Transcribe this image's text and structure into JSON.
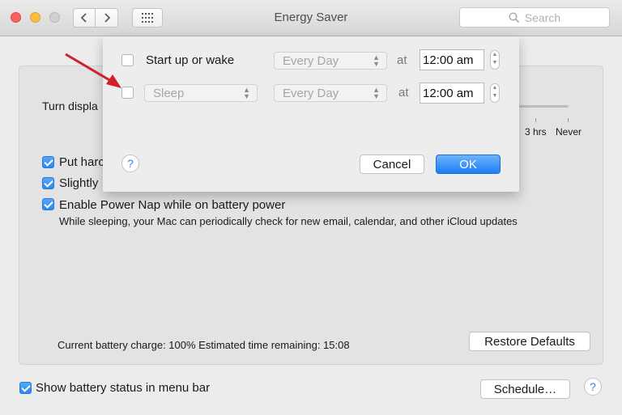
{
  "window": {
    "title": "Energy Saver",
    "search_placeholder": "Search"
  },
  "pane": {
    "turn_display_off_label": "Turn displa",
    "slider_tick_3hrs": "3 hrs",
    "slider_tick_never": "Never",
    "put_hard_disks_label": "Put harc",
    "slightly_dim_label": "Slightly",
    "power_nap_label": "Enable Power Nap while on battery power",
    "power_nap_desc": "While sleeping, your Mac can periodically check for new email, calendar, and other iCloud updates",
    "battery_status_text": "Current battery charge: 100%  Estimated time remaining: 15:08",
    "restore_defaults_label": "Restore Defaults"
  },
  "footer": {
    "show_battery_label": "Show battery status in menu bar",
    "schedule_label": "Schedule…",
    "help_label": "?"
  },
  "schedule_sheet": {
    "row1": {
      "checked": false,
      "label": "Start up or wake",
      "frequency": "Every Day",
      "at_label": "at",
      "time": "12:00 am"
    },
    "row2": {
      "checked": false,
      "action": "Sleep",
      "frequency": "Every Day",
      "at_label": "at",
      "time": "12:00 am"
    },
    "help_label": "?",
    "cancel_label": "Cancel",
    "ok_label": "OK"
  },
  "colors": {
    "accent": "#2f86ee",
    "annotation_arrow": "#d0202a"
  }
}
